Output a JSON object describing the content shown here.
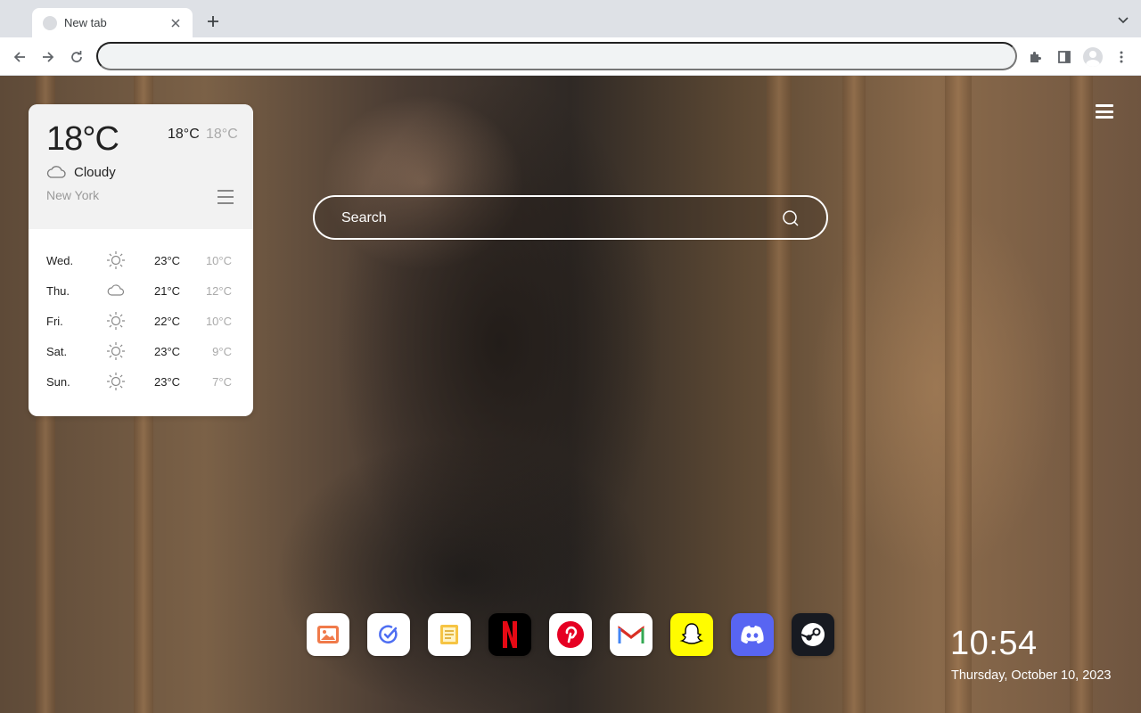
{
  "browser": {
    "tab_title": "New tab",
    "address_value": ""
  },
  "weather": {
    "current_temp": "18°C",
    "high": "18°C",
    "low": "18°C",
    "condition": "Cloudy",
    "condition_icon": "cloud-icon",
    "city": "New York",
    "forecast": [
      {
        "day": "Wed.",
        "icon": "sun-icon",
        "high": "23°C",
        "low": "10°C"
      },
      {
        "day": "Thu.",
        "icon": "cloud-icon",
        "high": "21°C",
        "low": "12°C"
      },
      {
        "day": "Fri.",
        "icon": "sun-icon",
        "high": "22°C",
        "low": "10°C"
      },
      {
        "day": "Sat.",
        "icon": "sun-icon",
        "high": "23°C",
        "low": "9°C"
      },
      {
        "day": "Sun.",
        "icon": "sun-icon",
        "high": "23°C",
        "low": "7°C"
      }
    ]
  },
  "search": {
    "placeholder": "Search"
  },
  "dock": {
    "apps": [
      {
        "name": "photos",
        "icon": "photos-icon",
        "color": "#ffffff"
      },
      {
        "name": "tasks",
        "icon": "check-icon",
        "color": "#ffffff"
      },
      {
        "name": "notes",
        "icon": "notes-icon",
        "color": "#ffffff"
      },
      {
        "name": "netflix",
        "icon": "netflix-icon",
        "color": "#000000"
      },
      {
        "name": "pinterest",
        "icon": "pinterest-icon",
        "color": "#ffffff"
      },
      {
        "name": "gmail",
        "icon": "gmail-icon",
        "color": "#ffffff"
      },
      {
        "name": "snapchat",
        "icon": "snapchat-icon",
        "color": "#fffc00"
      },
      {
        "name": "discord",
        "icon": "discord-icon",
        "color": "#5865f2"
      },
      {
        "name": "steam",
        "icon": "steam-icon",
        "color": "#171a21"
      }
    ]
  },
  "clock": {
    "time": "10:54",
    "date": "Thursday, October 10, 2023"
  }
}
